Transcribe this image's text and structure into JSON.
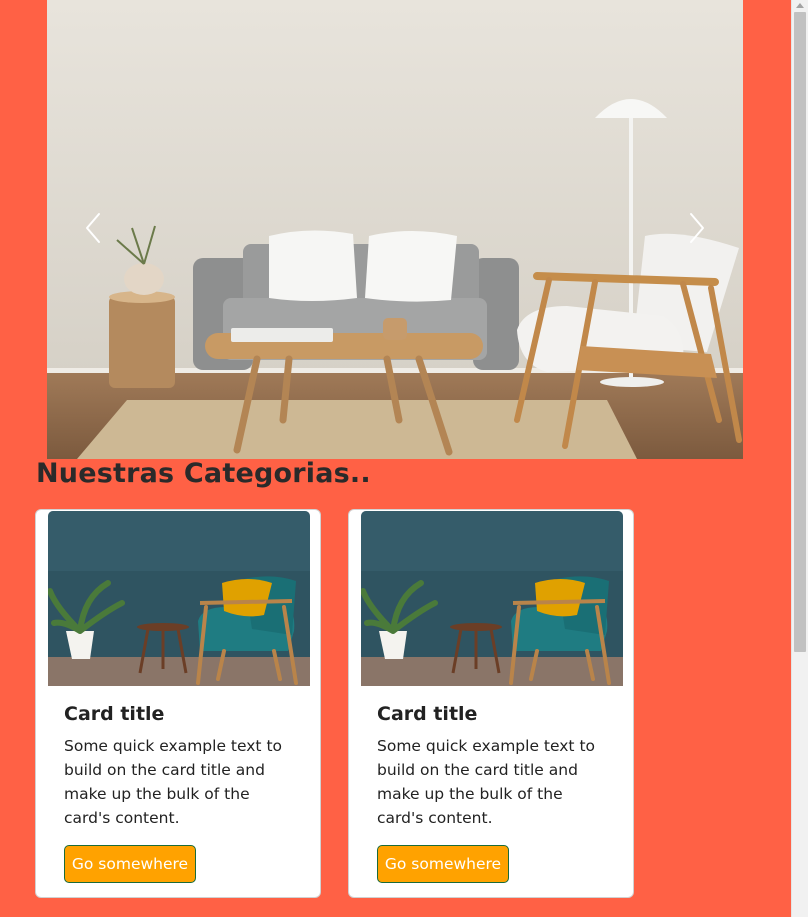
{
  "carousel": {
    "image": "living-room-photo",
    "prev_icon": "chevron-left-icon",
    "next_icon": "chevron-right-icon"
  },
  "section": {
    "title": "Nuestras Categorias.."
  },
  "cards": [
    {
      "image": "armchair-photo",
      "title": "Card title",
      "text": "Some quick example text to build on the card title and make up the bulk of the card's content.",
      "button": "Go somewhere"
    },
    {
      "image": "armchair-photo",
      "title": "Card title",
      "text": "Some quick example text to build on the card title and make up the bulk of the card's content.",
      "button": "Go somewhere"
    }
  ],
  "colors": {
    "page_background": "#ff6145",
    "button_background": "#ffa200",
    "button_border": "#1a6b3a"
  }
}
